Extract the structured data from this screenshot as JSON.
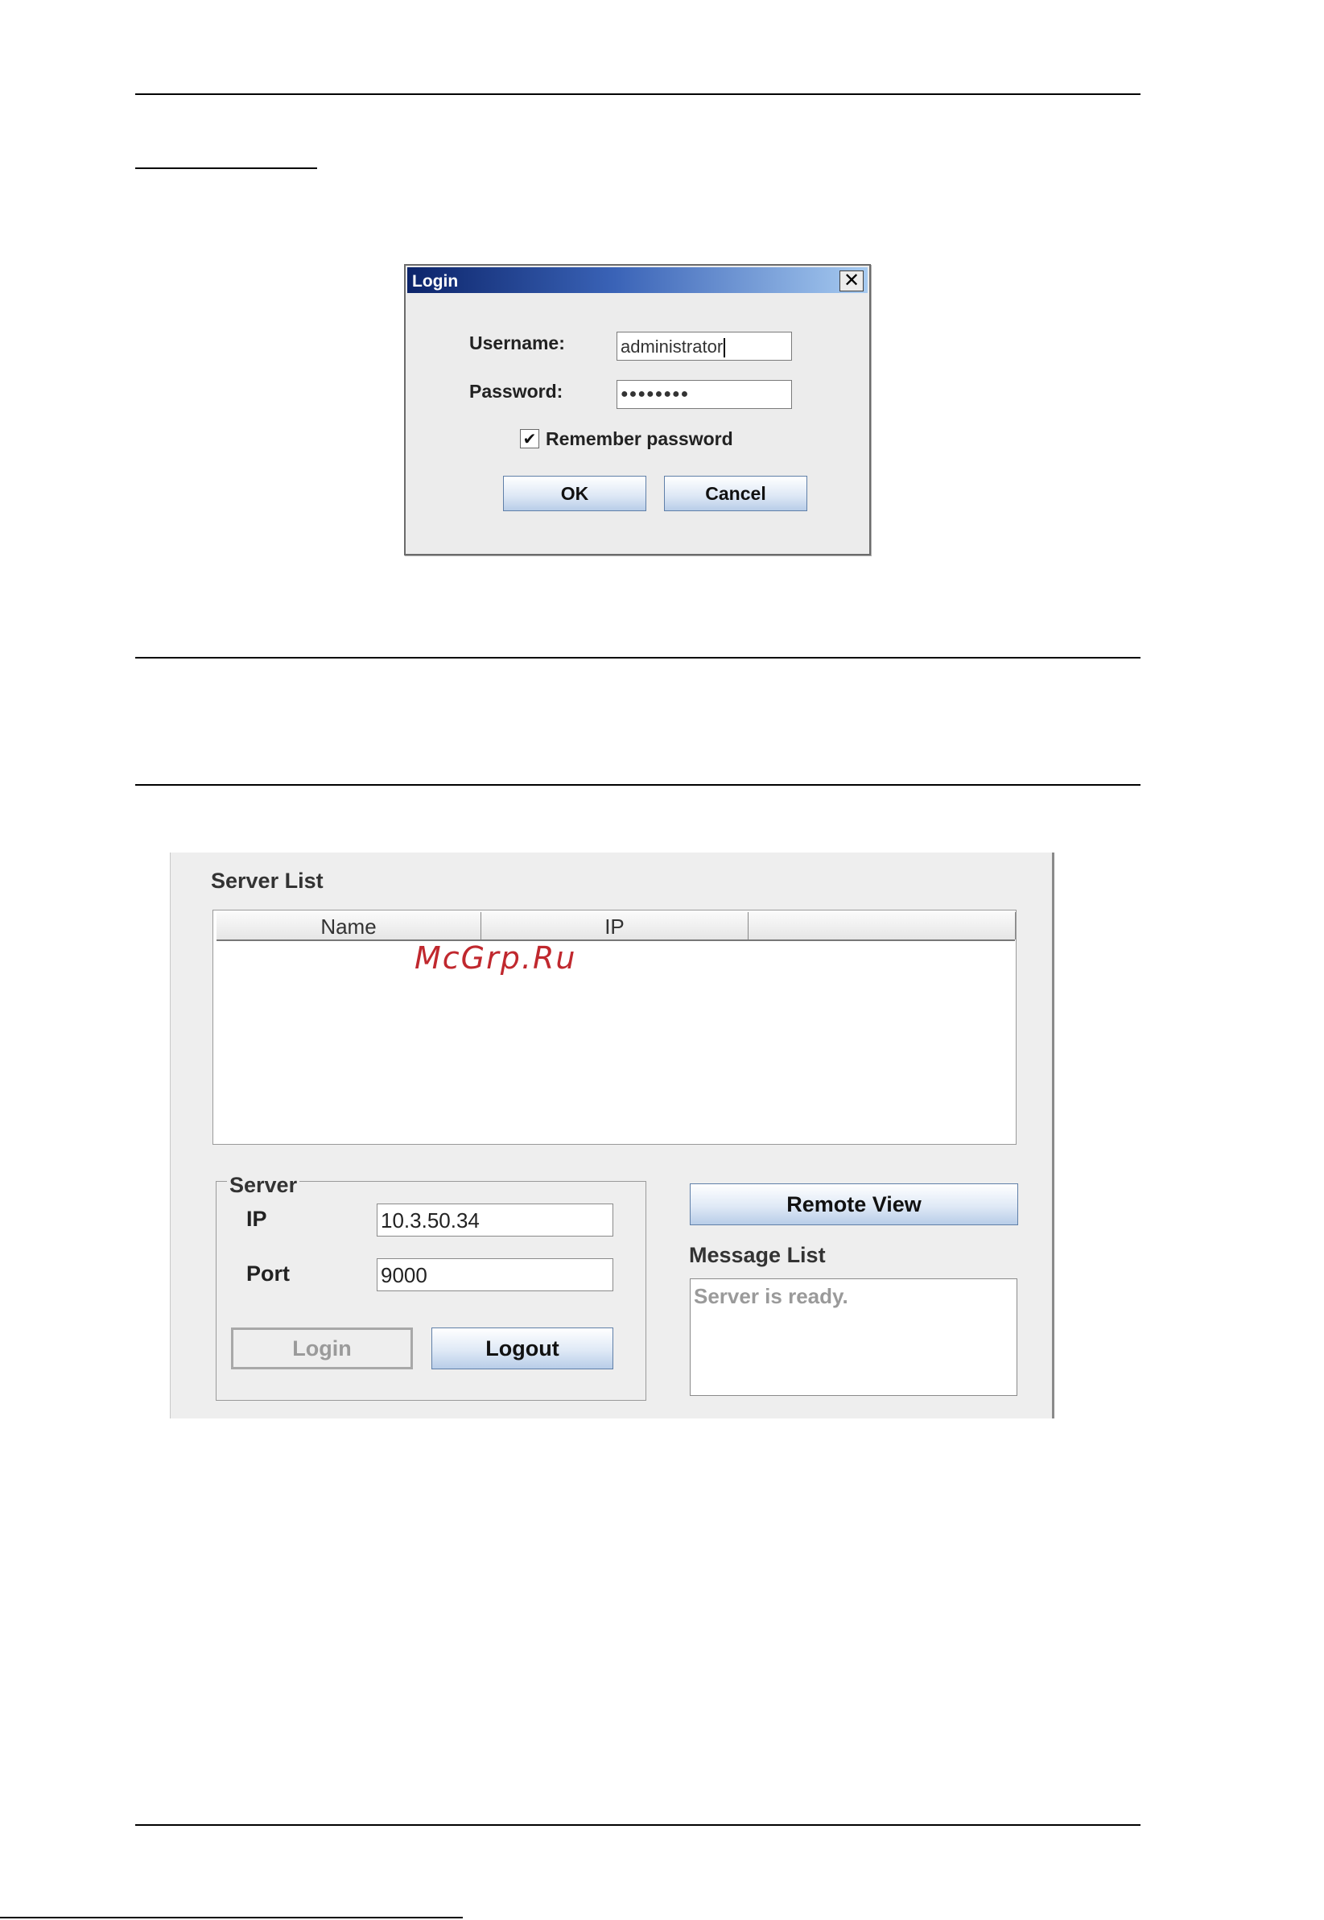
{
  "login_dialog": {
    "title": "Login",
    "close_glyph": "✕",
    "username_label": "Username:",
    "username_value": "administrator",
    "password_label": "Password:",
    "password_value": "●●●●●●●●",
    "check_glyph": "✔",
    "remember_label": "Remember password",
    "remember_checked": true,
    "ok_label": "OK",
    "cancel_label": "Cancel"
  },
  "server_panel": {
    "server_list_title": "Server List",
    "table": {
      "columns": [
        "Name",
        "IP",
        ""
      ],
      "rows": []
    },
    "server_group_title": "Server",
    "ip_label": "IP",
    "ip_value": "10.3.50.34",
    "port_label": "Port",
    "port_value": "9000",
    "login_label": "Login",
    "logout_label": "Logout",
    "remote_view_label": "Remote View",
    "message_list_title": "Message List",
    "messages": [
      "Server is ready."
    ]
  },
  "watermark": "McGrp.Ru"
}
